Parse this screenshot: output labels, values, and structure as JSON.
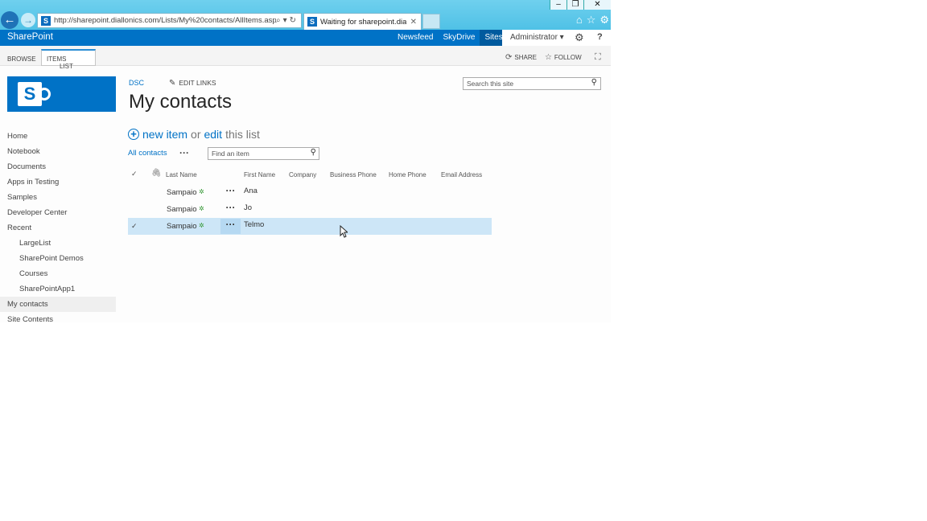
{
  "browser": {
    "url": "http://sharepoint.diallonics.com/Lists/My%20contacts/AllItems.asp",
    "tab_title": "Waiting for sharepoint.diall...",
    "window_buttons": [
      "‒",
      "❐",
      "✕"
    ]
  },
  "suitebar": {
    "brand": "SharePoint",
    "links": [
      "Newsfeed",
      "SkyDrive",
      "Sites"
    ],
    "user": "Administrator ▾",
    "help": "?"
  },
  "ribbon": {
    "tabs": [
      "BROWSE",
      "ITEMS",
      "LIST"
    ],
    "share": "SHARE",
    "follow": "FOLLOW"
  },
  "nav": {
    "items": [
      {
        "label": "Home",
        "sub": false
      },
      {
        "label": "Notebook",
        "sub": false
      },
      {
        "label": "Documents",
        "sub": false
      },
      {
        "label": "Apps in Testing",
        "sub": false
      },
      {
        "label": "Samples",
        "sub": false
      },
      {
        "label": "Developer Center",
        "sub": false
      },
      {
        "label": "Recent",
        "sub": false
      },
      {
        "label": "LargeList",
        "sub": true
      },
      {
        "label": "SharePoint Demos",
        "sub": true
      },
      {
        "label": "Courses",
        "sub": true
      },
      {
        "label": "SharePointApp1",
        "sub": true
      },
      {
        "label": "My contacts",
        "sub": false,
        "selected": true
      },
      {
        "label": "Site Contents",
        "sub": false
      }
    ]
  },
  "page": {
    "breadcrumb": "DSC",
    "edit_links": "EDIT LINKS",
    "title": "My contacts",
    "search_placeholder": "Search this site"
  },
  "list": {
    "new_item": "new item",
    "or": "or",
    "edit": "edit",
    "this_list": "this list",
    "view": "All contacts",
    "find_placeholder": "Find an item",
    "columns": [
      "Last Name",
      "First Name",
      "Company",
      "Business Phone",
      "Home Phone",
      "Email Address"
    ],
    "rows": [
      {
        "last": "Sampaio",
        "first": "Ana",
        "selected": false
      },
      {
        "last": "Sampaio",
        "first": "Jo",
        "selected": false
      },
      {
        "last": "Sampaio",
        "first": "Telmo",
        "selected": true
      }
    ]
  },
  "colors": {
    "accent": "#0072c6",
    "browser_chrome": "#4fc1e6",
    "selected_row": "#cde6f7"
  }
}
